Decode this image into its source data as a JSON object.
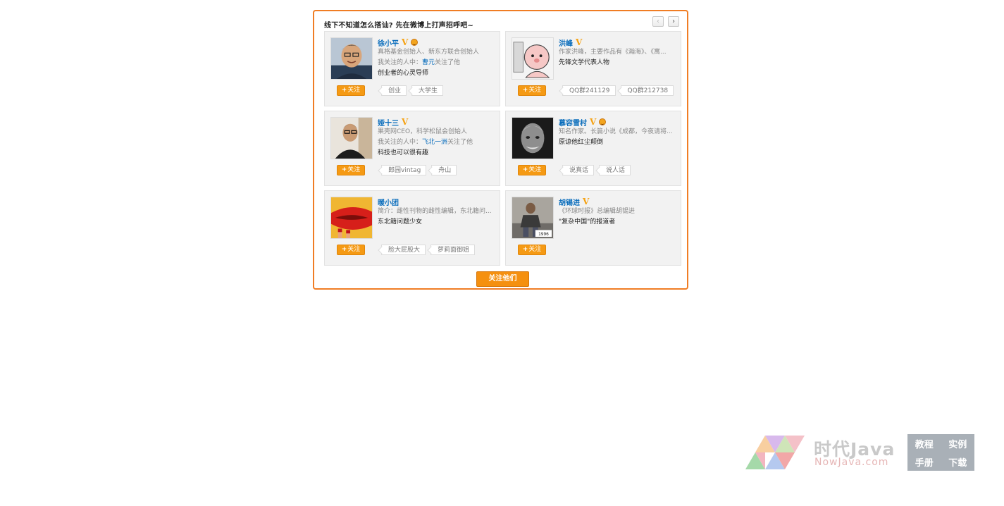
{
  "panel": {
    "title": "线下不知道怎么搭讪? 先在微博上打声招呼吧~",
    "prev_icon": "‹",
    "next_icon": "›",
    "follow_all_label": "关注他们"
  },
  "follow_label": "关注",
  "follow_plus": "+",
  "v_badge": "V",
  "colors": {
    "accent": "#f07d24",
    "button": "#f59a14",
    "link": "#0a6dbc",
    "badge": "#f5a214"
  },
  "cards": [
    {
      "name": "徐小平",
      "smile": true,
      "desc": "真格基金创始人、新东方联合创始人",
      "via_prefix": "我关注的人中：",
      "via_name": "曹元",
      "via_suffix": "关注了他",
      "tagline": "创业者的心灵导师",
      "tags": [
        "创业",
        "大学生"
      ]
    },
    {
      "name": "洪峰",
      "smile": false,
      "desc": "作家洪峰，主要作品有《瀚海》、《寓...",
      "tagline": "先锋文学代表人物",
      "tags": [
        "QQ群241129",
        "QQ群212738"
      ]
    },
    {
      "name": "娅十三",
      "smile": false,
      "desc": "果壳网CEO，科学松鼠会创始人",
      "via_prefix": "我关注的人中：",
      "via_name": "飞北一洲",
      "via_suffix": "关注了他",
      "tagline": "科技也可以很有趣",
      "tags": [
        "郎园vintag",
        "舟山"
      ]
    },
    {
      "name": "慕容雪村",
      "smile": true,
      "desc": "知名作家。长篇小说《成都，今夜请将...",
      "tagline": "原谅他红尘颠倒",
      "tags": [
        "说真话",
        "说人话"
      ]
    },
    {
      "name": "暖小团",
      "smile": false,
      "v": false,
      "desc": "简介：雌性刊物的雌性编辑，东北籍问...",
      "tagline": "东北籍问题少女",
      "tags": [
        "脸大屁股大",
        "萝莉面御姐"
      ]
    },
    {
      "name": "胡锡进",
      "smile": false,
      "desc": "《环球时报》总编辑胡锡进",
      "tagline": "\"复杂中国\"的报道者",
      "tags": []
    }
  ],
  "watermark": {
    "brand": "时代Java",
    "domain": "NowJava.com",
    "links": [
      "教程",
      "实例",
      "手册",
      "下载"
    ]
  }
}
